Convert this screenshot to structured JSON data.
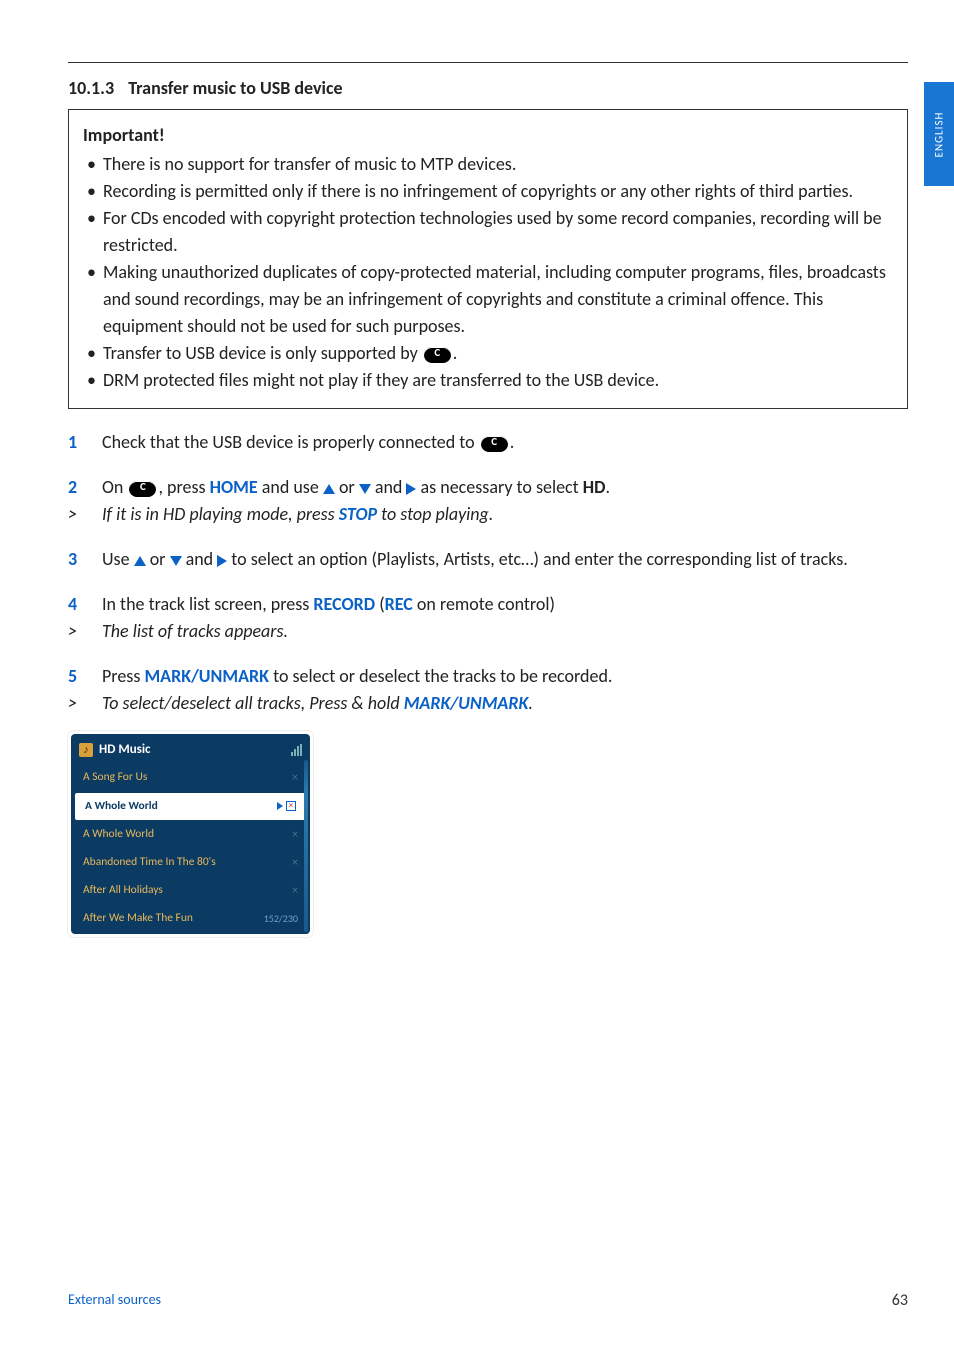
{
  "language_tab": "ENGLISH",
  "section": {
    "number": "10.1.3",
    "title": "Transfer music to USB device"
  },
  "important": {
    "heading": "Important!",
    "items": [
      "There is no support for transfer of music to MTP devices.",
      "Recording is permitted only if there is no infringement of copyrights or any other rights of third parties.",
      "For CDs encoded with copyright protection technologies used by some record companies, recording will be restricted.",
      "Making unauthorized duplicates of copy-protected material, including computer programs, files, broadcasts and sound recordings, may be an infringement of copyrights and constitute a criminal offence. This equipment should not be used for such purposes.",
      "Transfer to USB device is only supported by ",
      "DRM protected files might not play if they are transferred to the USB device."
    ],
    "badge_label": "C"
  },
  "steps": {
    "s1": {
      "num": "1",
      "text_a": "Check that the USB device is properly connected to ",
      "text_b": "."
    },
    "s2": {
      "num": "2",
      "on": "On ",
      "press": ", press ",
      "home": "HOME",
      "and_use": " and use ",
      "or": " or ",
      "and": " and ",
      "as_nec": " as necessary to select ",
      "hd": "HD",
      "period": "."
    },
    "s2sub": {
      "gt": ">",
      "a": "If it is in HD playing mode, press ",
      "stop": "STOP",
      "b": " to stop playing."
    },
    "s3": {
      "num": "3",
      "a": "Use ",
      "or": " or ",
      "and": " and ",
      "b": " to select an option (Playlists,  Artists, etc…) and enter the corresponding list of tracks."
    },
    "s4": {
      "num": "4",
      "a": "In the track list screen, press ",
      "record": "RECORD",
      "paren_a": " (",
      "rec": "REC",
      "paren_b": " on remote control)"
    },
    "s4sub": {
      "gt": ">",
      "text": "The list of tracks appears."
    },
    "s5": {
      "num": "5",
      "a": "Press ",
      "mu": "MARK/UNMARK",
      "b": " to select or deselect the tracks to be recorded."
    },
    "s5sub": {
      "gt": ">",
      "a": "To select/deselect all tracks, Press & hold ",
      "mu": "MARK/UNMARK",
      "b": "."
    }
  },
  "device": {
    "header": "HD Music",
    "tracks": [
      {
        "title": "A Song For Us",
        "selected": false
      },
      {
        "title": "A Whole World",
        "selected": true
      },
      {
        "title": "A Whole World",
        "selected": false
      },
      {
        "title": "Abandoned Time In The 80's",
        "selected": false
      },
      {
        "title": "After All Holidays",
        "selected": false
      },
      {
        "title": "After We Make The Fun",
        "selected": false
      }
    ],
    "counter": "152/230"
  },
  "footer": {
    "left": "External sources",
    "right": "63"
  }
}
